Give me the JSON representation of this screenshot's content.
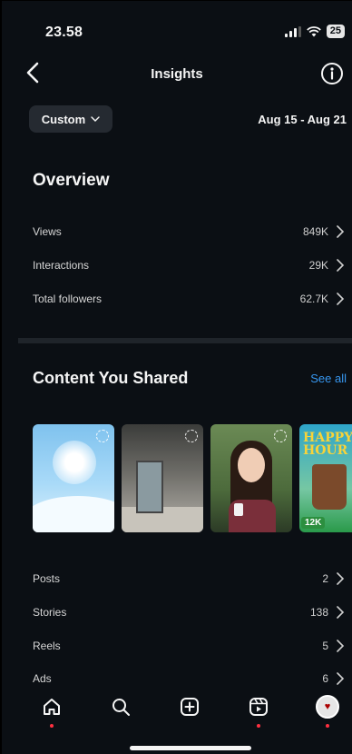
{
  "status_bar": {
    "time": "23.58",
    "battery": "25"
  },
  "header": {
    "title": "Insights"
  },
  "filter": {
    "label": "Custom",
    "date_range": "Aug 15 - Aug 21"
  },
  "overview": {
    "title": "Overview",
    "rows": [
      {
        "label": "Views",
        "value": "849K"
      },
      {
        "label": "Interactions",
        "value": "29K"
      },
      {
        "label": "Total followers",
        "value": "62.7K"
      }
    ]
  },
  "content": {
    "title": "Content You Shared",
    "see_all": "See all",
    "thumb_overlay": [
      "HAPPY",
      "HOUR",
      "12K"
    ],
    "rows": [
      {
        "label": "Posts",
        "value": "2"
      },
      {
        "label": "Stories",
        "value": "138"
      },
      {
        "label": "Reels",
        "value": "5"
      },
      {
        "label": "Ads",
        "value": "6"
      }
    ]
  },
  "icons": {
    "back": "chevron-left-icon",
    "info": "info-icon",
    "home": "home-icon",
    "search": "search-icon",
    "create": "plus-square-icon",
    "reels": "reels-icon",
    "profile": "avatar"
  },
  "colors": {
    "background": "#0b0f14",
    "link": "#3797f0",
    "notification": "#ff3040"
  }
}
